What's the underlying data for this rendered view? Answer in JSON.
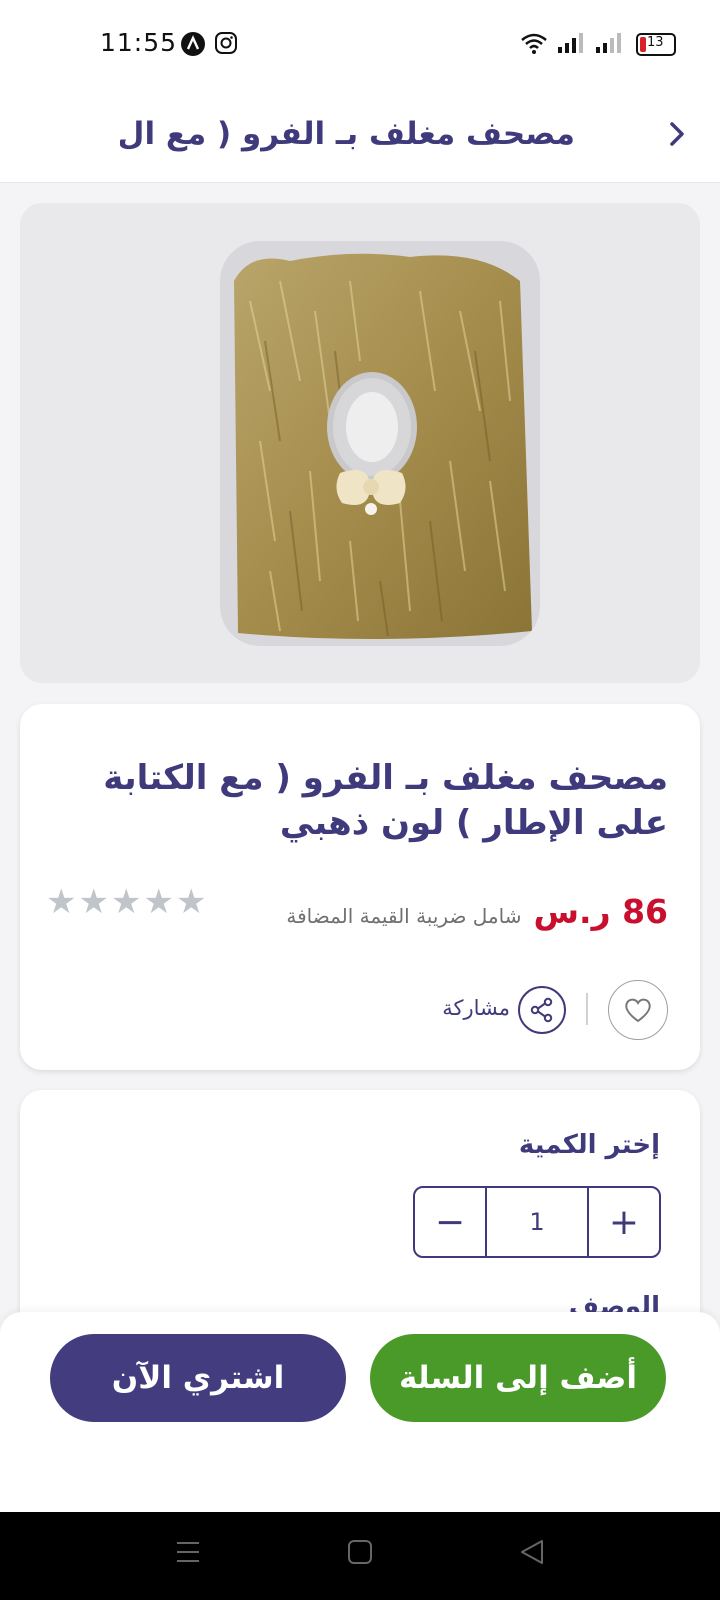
{
  "status_bar": {
    "time": "11:55",
    "battery": "13"
  },
  "header": {
    "title": "مصحف مغلف بـ الفرو ( مع ال.."
  },
  "product": {
    "title": "مصحف مغلف بـ الفرو ( مع الكتابة على الإطار ) لون ذهبي",
    "price": "86 ر.س",
    "vat_note": "شامل ضريبة القيمة المضافة",
    "rating": 0,
    "rating_max": 5,
    "share_label": "مشاركة"
  },
  "quantity": {
    "label": "إختر الكمية",
    "value": "1",
    "minus": "−",
    "plus": "+"
  },
  "description": {
    "label": "الوصف"
  },
  "actions": {
    "buy_now": "اشتري الآن",
    "add_to_cart": "أضف إلى السلة"
  },
  "colors": {
    "accent": "#3f3a7b",
    "price": "#c8102e",
    "cart": "#4a9a2a",
    "buy": "#433d7f"
  }
}
